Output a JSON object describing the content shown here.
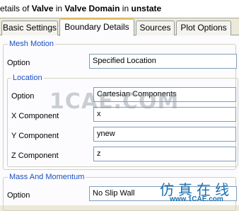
{
  "title": {
    "prefix": "etails of ",
    "object": "Valve",
    "in1": " in ",
    "domain": "Valve Domain",
    "in2": " in ",
    "case": "unstate"
  },
  "tabs": [
    {
      "label": "Basic Settings"
    },
    {
      "label": "Boundary Details"
    },
    {
      "label": "Sources"
    },
    {
      "label": "Plot Options"
    }
  ],
  "mesh_motion": {
    "legend": "Mesh Motion",
    "option_label": "Option",
    "option_value": "Specified Location",
    "location": {
      "legend": "Location",
      "option_label": "Option",
      "option_value": "Cartesian Components",
      "x_label": "X Component",
      "x_value": "x",
      "y_label": "Y Component",
      "y_value": "ynew",
      "z_label": "Z Component",
      "z_value": "z"
    }
  },
  "mass_momentum": {
    "legend": "Mass And Momentum",
    "option_label": "Option",
    "option_value": "No Slip Wall"
  },
  "watermarks": {
    "main": "1CAE.COM",
    "chinese": "仿真在线",
    "url": "www.1CAE.com"
  }
}
